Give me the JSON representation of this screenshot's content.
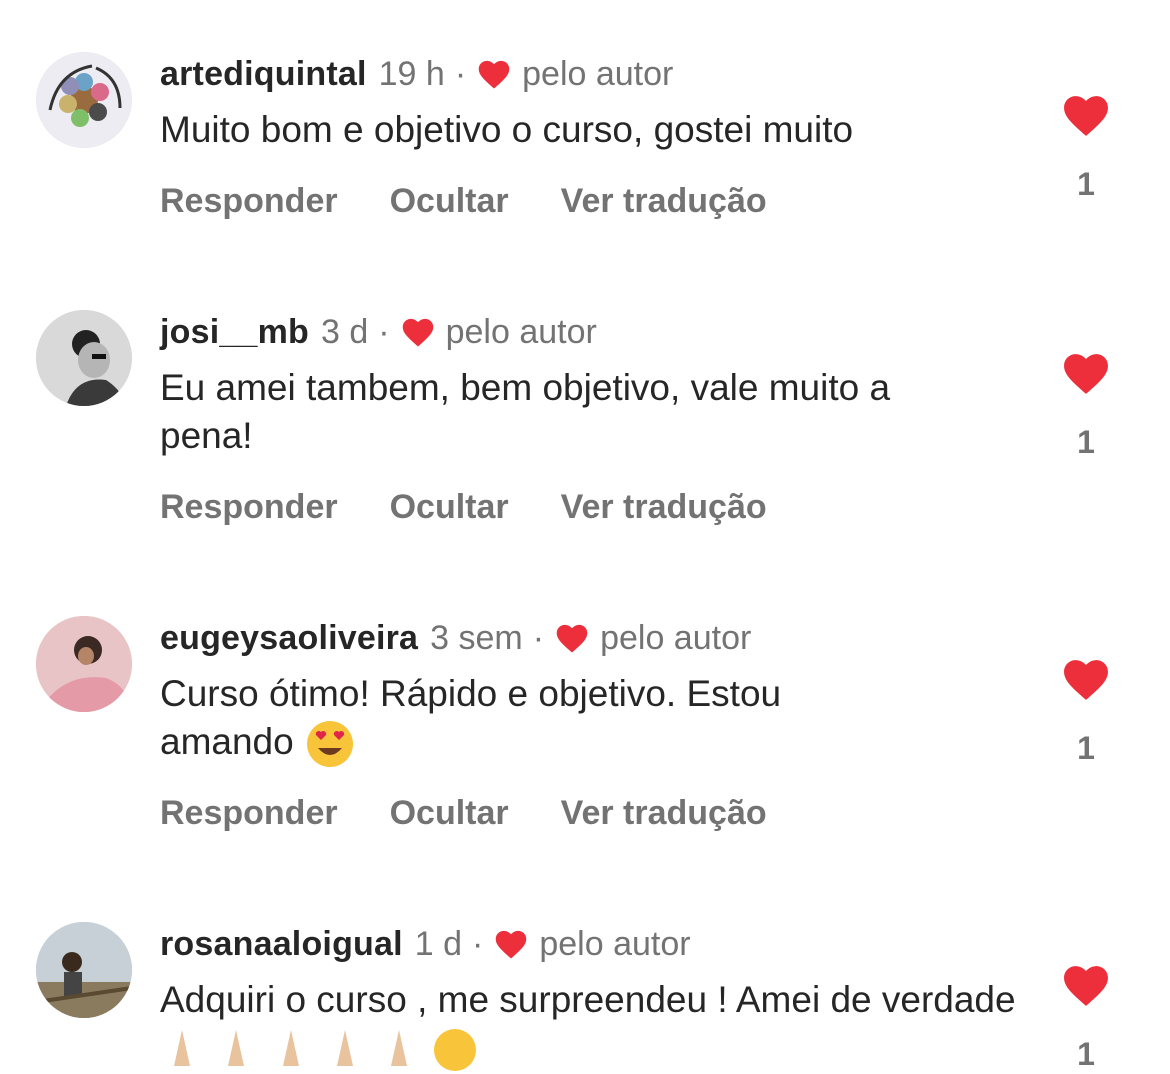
{
  "comments": [
    {
      "username": "artediquintal",
      "time": "19 h",
      "author_label": "pelo autor",
      "text": "Muito bom e objetivo o curso, gostei muito",
      "likes": "1"
    },
    {
      "username": "josi__mb",
      "time": "3 d",
      "author_label": "pelo autor",
      "text": "Eu amei tambem, bem objetivo, vale muito a pena!",
      "likes": "1"
    },
    {
      "username": "eugeysaoliveira",
      "time": "3 sem",
      "author_label": "pelo autor",
      "text": "Curso ótimo! Rápido e objetivo. Estou amando",
      "likes": "1"
    },
    {
      "username": "rosanaaloigual",
      "time": "1 d",
      "author_label": "pelo autor",
      "text": "Adquiri o curso , me surpreendeu ! Amei de verdade",
      "likes": "1"
    }
  ],
  "actions": {
    "reply": "Responder",
    "hide": "Ocultar",
    "translate": "Ver tradução"
  },
  "separator": "·",
  "colors": {
    "heart_red": "#ed2f3c",
    "secondary_text": "#737373",
    "primary_text": "#262626"
  },
  "icons": {
    "author_like": "heart-icon",
    "like": "heart-icon",
    "emoji_love": "heart-eyes-emoji",
    "emoji_pray": "folded-hands-emoji",
    "emoji_wink": "winking-face-emoji"
  }
}
